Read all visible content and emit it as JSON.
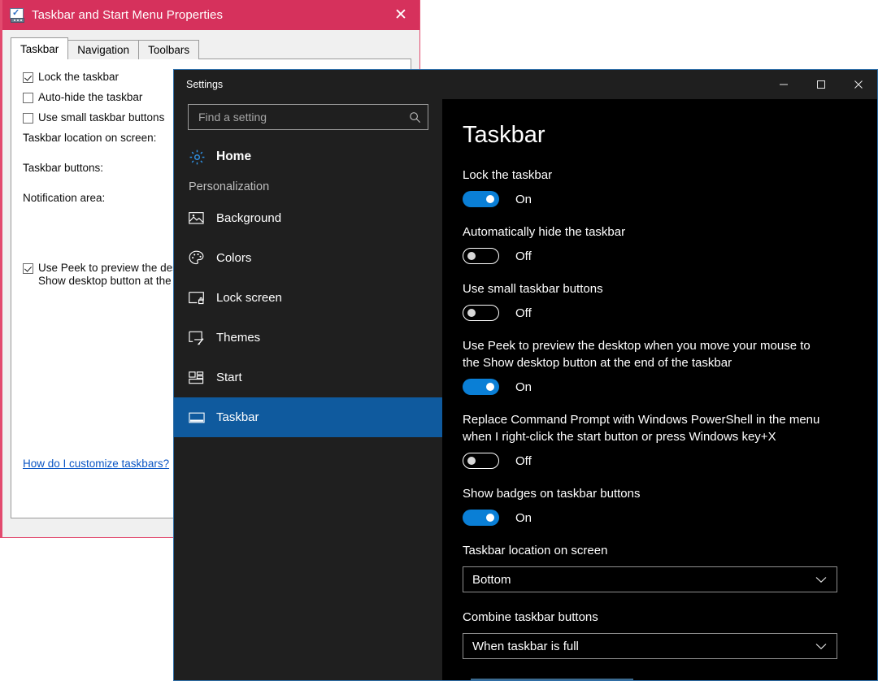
{
  "props_dialog": {
    "title": "Taskbar and Start Menu Properties",
    "icon": "taskbar-properties-icon",
    "close_label": "✕",
    "tabs": [
      {
        "label": "Taskbar",
        "selected": true
      },
      {
        "label": "Navigation",
        "selected": false
      },
      {
        "label": "Toolbars",
        "selected": false
      }
    ],
    "checkboxes": [
      {
        "label": "Lock the taskbar",
        "checked": true
      },
      {
        "label": "Auto-hide the taskbar",
        "checked": false
      },
      {
        "label": "Use small taskbar buttons",
        "checked": false
      }
    ],
    "field_labels": [
      "Taskbar location on screen:",
      "Taskbar buttons:",
      "Notification area:"
    ],
    "peek_checkbox": {
      "checked": true,
      "line1": "Use Peek to preview the desktop when you move your mouse to the",
      "line2": "Show desktop button at the end of the taskbar"
    },
    "help_link": "How do I customize taskbars?",
    "ok_button": ""
  },
  "settings_window": {
    "title": "Settings",
    "window_controls": [
      {
        "name": "minimize",
        "glyph": "─"
      },
      {
        "name": "maximize",
        "glyph": "☐"
      },
      {
        "name": "close",
        "glyph": "✕"
      }
    ],
    "search": {
      "placeholder": "Find a setting",
      "value": "",
      "icon": "search-icon"
    },
    "sidebar": {
      "home": {
        "label": "Home",
        "icon": "gear-icon"
      },
      "section_title": "Personalization",
      "items": [
        {
          "label": "Background",
          "icon": "picture-icon",
          "selected": false
        },
        {
          "label": "Colors",
          "icon": "palette-icon",
          "selected": false
        },
        {
          "label": "Lock screen",
          "icon": "lock-screen-icon",
          "selected": false
        },
        {
          "label": "Themes",
          "icon": "themes-brush-icon",
          "selected": false
        },
        {
          "label": "Start",
          "icon": "start-tiles-icon",
          "selected": false
        },
        {
          "label": "Taskbar",
          "icon": "taskbar-icon",
          "selected": true
        }
      ]
    },
    "content": {
      "title": "Taskbar",
      "toggles": [
        {
          "label": "Lock the taskbar",
          "state": "On",
          "on": true
        },
        {
          "label": "Automatically hide the taskbar",
          "state": "Off",
          "on": false
        },
        {
          "label": "Use small taskbar buttons",
          "state": "Off",
          "on": false
        },
        {
          "label": "Use Peek to preview the desktop when you move your mouse to the Show desktop button at the end of the taskbar",
          "state": "On",
          "on": true
        },
        {
          "label": "Replace Command Prompt with Windows PowerShell in the menu when I right-click the start button or press Windows key+X",
          "state": "Off",
          "on": false
        },
        {
          "label": "Show badges on taskbar buttons",
          "state": "On",
          "on": true
        }
      ],
      "dropdowns": [
        {
          "label": "Taskbar location on screen",
          "value": "Bottom"
        },
        {
          "label": "Combine taskbar buttons",
          "value": "When taskbar is full"
        }
      ]
    }
  },
  "colors": {
    "props_title_bar": "#d6315c",
    "props_border": "#e24a6e",
    "settings_accent": "#0a7fd6",
    "settings_selected_nav": "#0f5a9e",
    "settings_sidebar_bg": "#1f1f1f",
    "settings_content_bg": "#000000",
    "link_color": "#0a55c4"
  }
}
